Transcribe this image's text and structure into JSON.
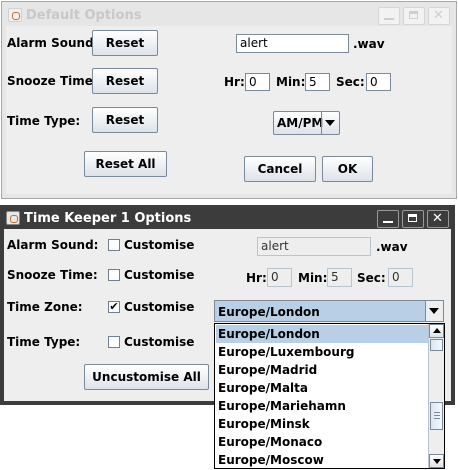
{
  "default_window": {
    "title": "Default Options",
    "alarm_label": "Alarm Sound:",
    "snooze_label": "Snooze Time:",
    "type_label": "Time Type:",
    "alarm_reset": "Reset",
    "snooze_reset": "Reset",
    "type_reset": "Reset",
    "reset_all": "Reset All",
    "alarm_value": "alert",
    "alarm_ext": ".wav",
    "hr_label": "Hr:",
    "hr_value": "0",
    "min_label": "Min:",
    "min_value": "5",
    "sec_label": "Sec:",
    "sec_value": "0",
    "time_type_value": "AM/PM",
    "cancel": "Cancel",
    "ok": "OK"
  },
  "keeper_window": {
    "title": "Time Keeper 1 Options",
    "alarm_label": "Alarm Sound:",
    "snooze_label": "Snooze Time:",
    "zone_label": "Time Zone:",
    "type_label": "Time Type:",
    "customise": "Customise",
    "alarm_customised": false,
    "snooze_customised": false,
    "zone_customised": true,
    "type_customised": false,
    "check_mark": "✔",
    "alarm_value": "alert",
    "alarm_ext": ".wav",
    "hr_label": "Hr:",
    "hr_value": "0",
    "min_label": "Min:",
    "min_value": "5",
    "sec_label": "Sec:",
    "sec_value": "0",
    "zone_value": "Europe/London",
    "uncustomise_all": "Uncustomise All"
  },
  "zone_dropdown": {
    "options": [
      "Europe/London",
      "Europe/Luxembourg",
      "Europe/Madrid",
      "Europe/Malta",
      "Europe/Mariehamn",
      "Europe/Minsk",
      "Europe/Monaco",
      "Europe/Moscow"
    ],
    "selected": "Europe/London"
  },
  "colors": {
    "selection": "#b8cfe5",
    "active_titlebar": "#3c3c3c",
    "inactive_titlebar": "#e6e6e6"
  },
  "icons": [
    "java-app-icon",
    "minimize-icon",
    "maximize-icon",
    "close-icon",
    "dropdown-arrow-icon",
    "scroll-up-icon",
    "scroll-down-icon"
  ]
}
